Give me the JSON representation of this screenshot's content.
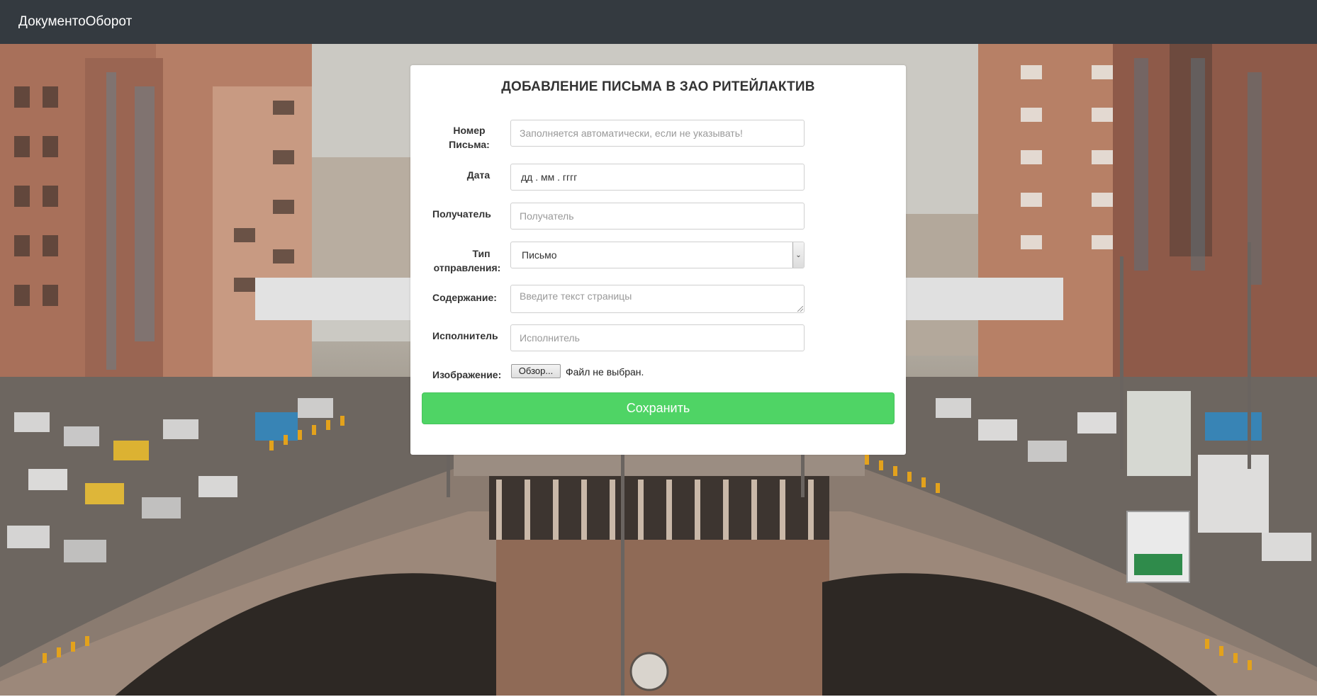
{
  "navbar": {
    "brand": "ДокументоОборот"
  },
  "form": {
    "title": "ДОБАВЛЕНИЕ ПИСЬМА В ЗАО РИТЕЙЛАКТИВ",
    "fields": {
      "number": {
        "label_line1": "Номер",
        "label_line2": "Письма:",
        "placeholder": "Заполняется автоматически, если не указывать!"
      },
      "date": {
        "label": "Дата",
        "placeholder": "дд . мм . гггг"
      },
      "recipient": {
        "label": "Получатель",
        "placeholder": "Получатель"
      },
      "send_type": {
        "label_line1": "Тип",
        "label_line2": "отправления:",
        "selected": "Письмо"
      },
      "content": {
        "label": "Содержание:",
        "placeholder": "Введите текст страницы"
      },
      "executor": {
        "label": "Исполнитель",
        "placeholder": "Исполнитель"
      },
      "image": {
        "label": "Изображение:",
        "browse_label": "Обзор...",
        "status": "Файл не выбран."
      }
    },
    "submit_label": "Сохранить"
  },
  "colors": {
    "navbar": "#343a40",
    "submit": "#4fd465"
  }
}
